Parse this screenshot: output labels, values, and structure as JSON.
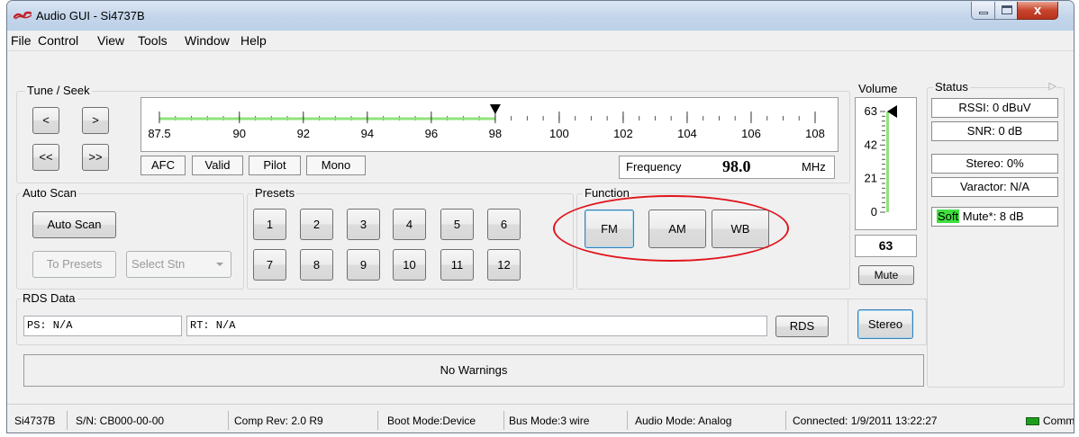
{
  "window": {
    "title": "Audio GUI - Si4737B",
    "close_glyph": "x",
    "icon": "silabs-logo-icon"
  },
  "menu": [
    "File",
    "Control",
    "View",
    "Tools",
    "Window",
    "Help"
  ],
  "tune_seek": {
    "label": "Tune / Seek",
    "buttons": [
      "<",
      ">",
      "<<",
      ">>"
    ]
  },
  "scale": {
    "ticks": [
      "87.5",
      "90",
      "92",
      "94",
      "96",
      "98",
      "100",
      "102",
      "104",
      "106",
      "108"
    ],
    "min_mhz": 87.5,
    "max_mhz": 108,
    "tuned_mhz": 98.0,
    "indicator_color": "#8fe37a"
  },
  "indicators": [
    "AFC",
    "Valid",
    "Pilot",
    "Mono"
  ],
  "frequency": {
    "label": "Frequency",
    "value": "98.0",
    "unit": "MHz"
  },
  "auto_scan": {
    "label": "Auto Scan",
    "button": "Auto Scan",
    "to_presets": "To Presets",
    "select_station": "Select Stn"
  },
  "presets": {
    "label": "Presets",
    "buttons": [
      "1",
      "2",
      "3",
      "4",
      "5",
      "6",
      "7",
      "8",
      "9",
      "10",
      "11",
      "12"
    ]
  },
  "function": {
    "label": "Function",
    "buttons": [
      "FM",
      "AM",
      "WB"
    ],
    "selected": "FM",
    "highlight_color": "#e0151c"
  },
  "volume": {
    "label": "Volume",
    "ticks": [
      "63",
      "42",
      "21",
      "0"
    ],
    "value": "63",
    "level": 63,
    "max": 63,
    "mute": "Mute",
    "stereo": "Stereo"
  },
  "status": {
    "label": "Status",
    "rssi": "RSSI: 0 dBuV",
    "snr": "SNR: 0 dB",
    "stereo": "Stereo: 0%",
    "varactor": "Varactor: N/A",
    "softmute_prefix": "Soft",
    "softmute_rest": " Mute*: 8 dB",
    "softmute_color": "#3fe03f"
  },
  "rds": {
    "label": "RDS Data",
    "ps": "PS: N/A",
    "rt": "RT: N/A",
    "button": "RDS"
  },
  "warnings": "No Warnings",
  "statusbar": {
    "device": "Si4737B",
    "serial": "S/N: CB000-00-00",
    "comp_rev": "Comp Rev: 2.0 R9",
    "boot_mode": "Boot Mode:Device",
    "bus_mode": "Bus Mode:3 wire",
    "audio_mode": "Audio Mode: Analog",
    "connected": "Connected: 1/9/2011 13:22:27",
    "comm": "Comm",
    "comm_color": "#1e9c1e"
  }
}
